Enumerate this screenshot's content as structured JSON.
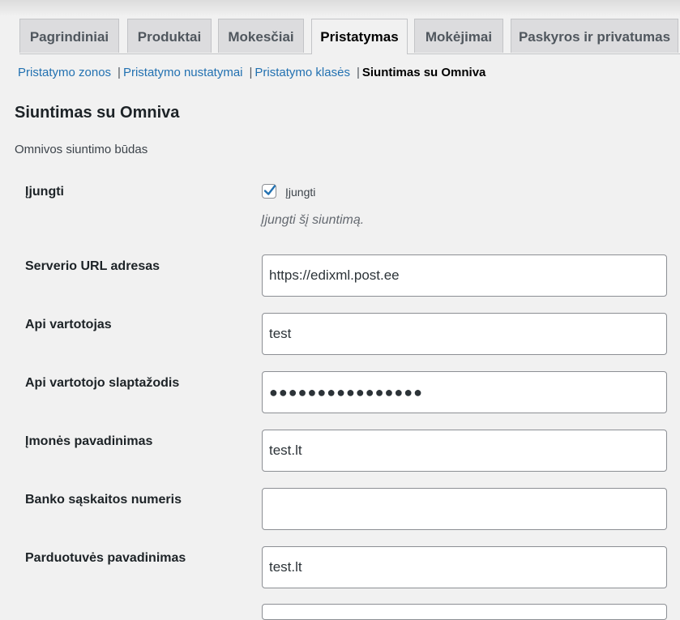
{
  "tabs": [
    {
      "label": "Pagrindiniai"
    },
    {
      "label": "Produktai"
    },
    {
      "label": "Mokesčiai"
    },
    {
      "label": "Pristatymas"
    },
    {
      "label": "Mokėjimai"
    },
    {
      "label": "Paskyros ir privatumas"
    }
  ],
  "active_tab": "Pristatymas",
  "subnav": {
    "links": [
      "Pristatymo zonos",
      "Pristatymo nustatymai",
      "Pristatymo klasės"
    ],
    "current": "Siuntimas su Omniva",
    "separator": "|"
  },
  "section": {
    "title": "Siuntimas su Omniva",
    "description": "Omnivos siuntimo būdas"
  },
  "enable": {
    "label": "Įjungti",
    "checkbox_label": "Įjungti",
    "checked": true,
    "description": "Įjungti šį siuntimą."
  },
  "fields": [
    {
      "label": "Serverio URL adresas",
      "value": "https://edixml.post.ee"
    },
    {
      "label": "Api vartotojas",
      "value": "test"
    },
    {
      "label": "Api vartotojo slaptažodis",
      "value": "●●●●●●●●●●●●●●●●"
    },
    {
      "label": "Įmonės pavadinimas",
      "value": "test.lt"
    },
    {
      "label": "Banko sąskaitos numeris",
      "value": ""
    },
    {
      "label": "Parduotuvės pavadinimas",
      "value": "test.lt"
    }
  ],
  "colors": {
    "link": "#2271b1",
    "checkmark": "#2271b1",
    "background": "#f1f1f1"
  }
}
